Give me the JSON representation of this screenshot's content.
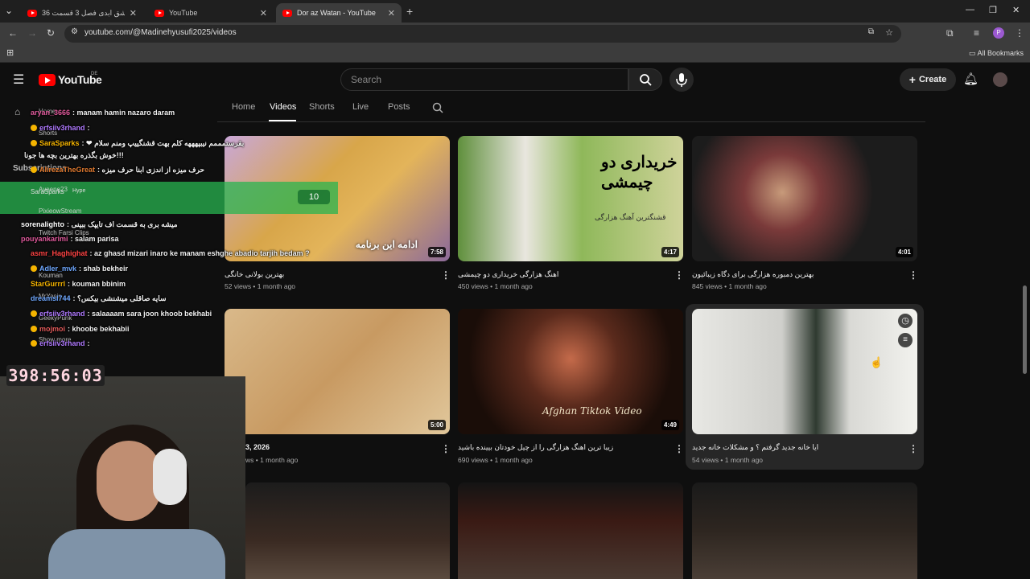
{
  "browser": {
    "tabs": [
      {
        "title": "عشق ابدی فصل 3 قسمت 36 - ..."
      },
      {
        "title": "YouTube"
      },
      {
        "title": "Dor az Watan - YouTube"
      }
    ],
    "url": "youtube.com/@Madinehyusufi2025/videos",
    "bookmarks_label": "All Bookmarks"
  },
  "youtube": {
    "logo_text": "YouTube",
    "country": "DE",
    "search_placeholder": "Search",
    "create_label": "Create"
  },
  "channel_tabs": [
    "Home",
    "Videos",
    "Shorts",
    "Live",
    "Posts"
  ],
  "active_tab": "Videos",
  "videos": [
    {
      "title": "بهترین بولانی خانگی",
      "meta": "52 views • 1 month ago",
      "duration": "7:58",
      "thumb_text": "ادامه این برنامه"
    },
    {
      "title": "اهنگ هزارگی خریداری دو چیمشی",
      "meta": "450 views • 1 month ago",
      "duration": "4:17",
      "thumb_text": "خریداری دو چیمشی",
      "thumb_sub": "قشنگترین آهنگ هزارگی"
    },
    {
      "title": "بهترین دمبوره هزارگی برای دگاه زیبائیون",
      "meta": "845 views • 1 month ago",
      "duration": "4:01"
    },
    {
      "title": "3, 2026",
      "meta": "ws • 1 month ago",
      "duration": "5:00"
    },
    {
      "title": "زیبا ترین اهنگ هزارگی را از چیل خودتان بیینده باشید",
      "meta": "690 views • 1 month ago",
      "duration": "4:49",
      "thumb_text": "Afghan Tiktok Video"
    },
    {
      "title": "ایا خانه جدید گرفتم ؟ و مشکلات خانه جدید",
      "meta": "54 views • 1 month ago",
      "duration": ""
    }
  ],
  "chat": [
    {
      "user": "aryan_3666",
      "msg": ": manam hamin nazaro daram",
      "color": "#e05a9c"
    },
    {
      "user": "erfsiiv3rhand",
      "msg": ":",
      "color": "#b07aff"
    },
    {
      "user": "SaraSparks",
      "msg": ": ❤ بقرستمممم نیبپهههه کلم بهت قشنگییپ ومنم سلام",
      "color": "#f5b400"
    },
    {
      "user": "",
      "msg": "خوش بگذره بهترین بچه ها جونا!!!",
      "color": "#ffffff"
    },
    {
      "user": "AlirezaTheGreat",
      "msg": ": حرف میزه از اندزی ابنا حرف میزه",
      "color": "#e07a30"
    },
    {
      "user": "sorenalighto",
      "msg": ": میشه بری به قسمت اف تایپک ببینی",
      "color": "#ffffff"
    },
    {
      "user": "pouyankarimi",
      "msg": ": salam parisa",
      "color": "#e05a9c"
    },
    {
      "user": "asmr_Haghighat",
      "msg": ": az ghasd mizari inaro ke manam eshghe abadio tarjih bedam ?",
      "color": "#ff4444"
    },
    {
      "user": "Adler_mvk",
      "msg": ": shab bekheir",
      "color": "#6fa8ff"
    },
    {
      "user": "StarGurrrl",
      "msg": ": kouman bbinim",
      "color": "#f5b400"
    },
    {
      "user": "dreamsI744",
      "msg": ": سایه صاقلی میشنشی بیکس؟",
      "color": "#6fa8ff"
    },
    {
      "user": "erfsiiv3rhand",
      "msg": ": salaaaam sara joon   khoob bekhabi",
      "color": "#b07aff"
    },
    {
      "user": "mojmoi",
      "msg": ": khoobe bekhabii",
      "color": "#e05a5a"
    },
    {
      "user": "erfsiiv3rhand",
      "msg": ":",
      "color": "#b07aff"
    }
  ],
  "sidebar_ghost": [
    "Home",
    "Shorts",
    "Subscriptions",
    "Ayeene23",
    "PixieowStream",
    "Twitch Farsi Clips",
    "Kouman",
    "MrYasin",
    "GeekyPunk",
    "Show more"
  ],
  "hype": {
    "user": "SaraSparks",
    "label": "Hype",
    "count": "10"
  },
  "timer": "398:56:03"
}
